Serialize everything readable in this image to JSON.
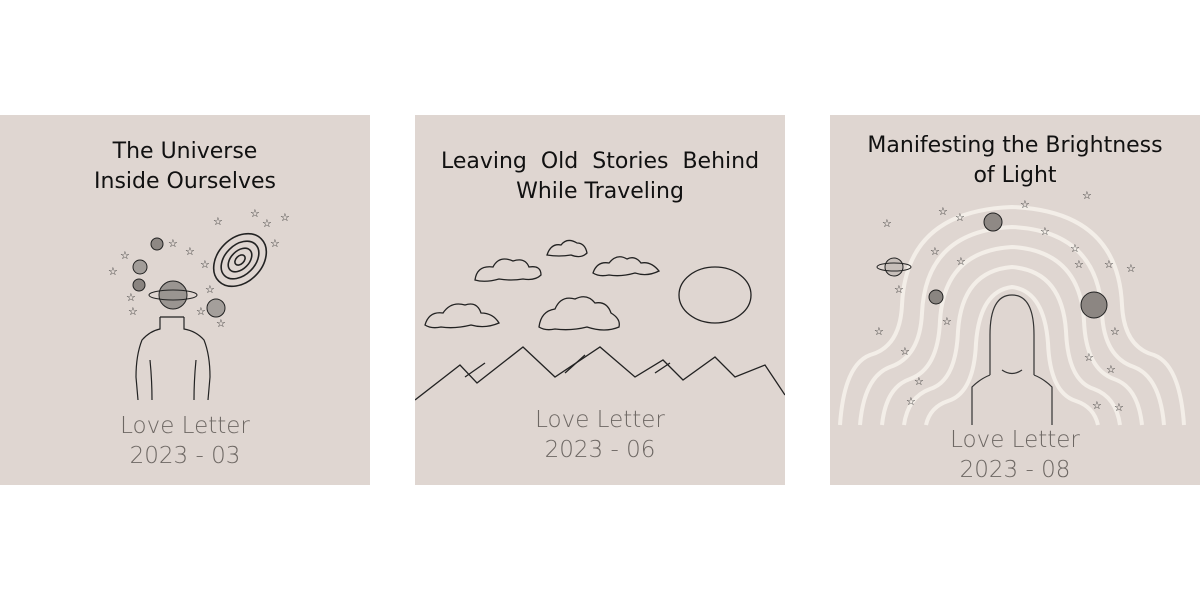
{
  "cards": [
    {
      "title_lines": [
        "The Universe",
        "Inside Ourselves"
      ],
      "label": "Love Letter",
      "date": "2023 - 03"
    },
    {
      "title_lines": [
        "Leaving  Old  Stories  Behind",
        "While Traveling"
      ],
      "label": "Love Letter",
      "date": "2023 - 06"
    },
    {
      "title_lines": [
        "Manifesting the Brightness",
        "of Light"
      ],
      "label": "Love Letter",
      "date": "2023 - 08"
    }
  ],
  "colors": {
    "card_background": "#dfd6d1",
    "title_text": "#111111",
    "footer_text": "#6d6763",
    "line_art": "#222222",
    "light_rays": "#f3eee8"
  },
  "icons": [
    "planet-icon",
    "galaxy-spiral-icon",
    "star-icon",
    "cloud-icon",
    "sun-icon",
    "mountain-range-icon",
    "person-silhouette-icon"
  ]
}
